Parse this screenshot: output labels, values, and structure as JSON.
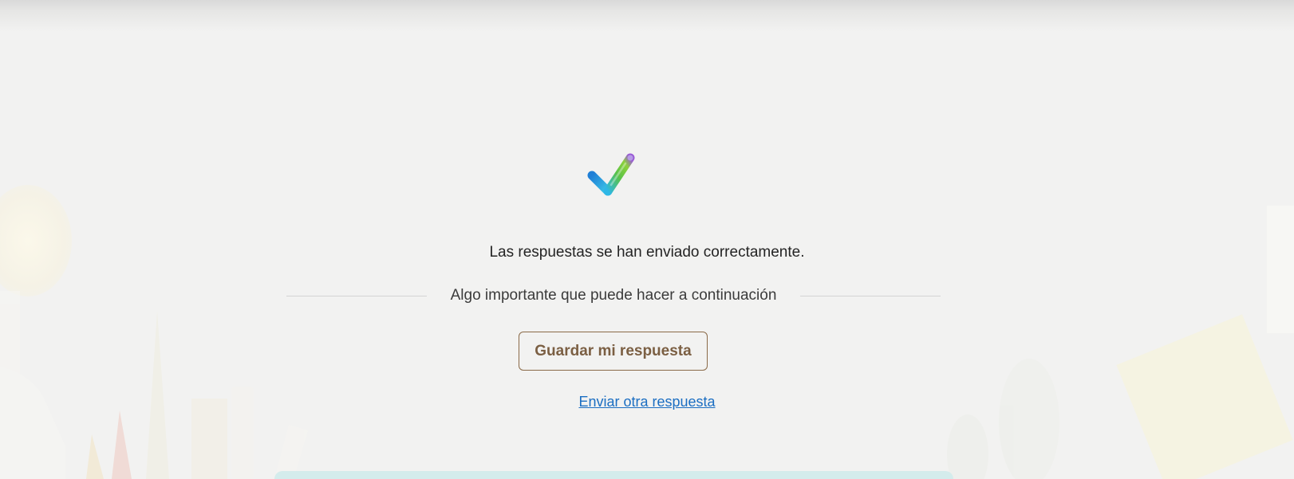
{
  "confirmation": {
    "message": "Las respuestas se han enviado correctamente.",
    "next_steps_title": "Algo importante que puede hacer a continuación",
    "save_button_label": "Guardar mi respuesta",
    "another_response_link": "Enviar otra respuesta"
  },
  "icons": {
    "success": "checkmark-icon"
  },
  "colors": {
    "background": "#f2f2f1",
    "button_border": "#8a6a48",
    "button_text": "#7b5f43",
    "link": "#1b6ec2",
    "card_accent": "#d4ecec"
  }
}
